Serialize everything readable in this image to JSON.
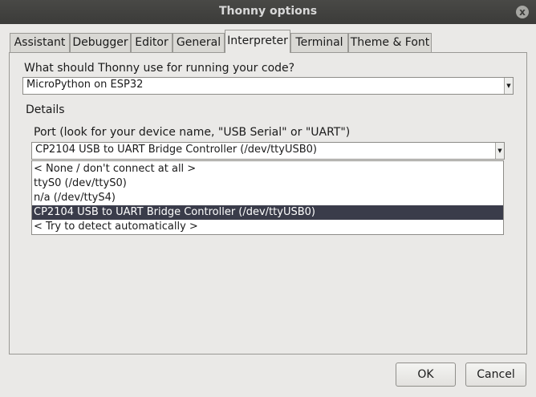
{
  "window": {
    "title": "Thonny options",
    "close_label": "x"
  },
  "tabs": [
    {
      "label": "Assistant",
      "active": false
    },
    {
      "label": "Debugger",
      "active": false
    },
    {
      "label": "Editor",
      "active": false
    },
    {
      "label": "General",
      "active": false
    },
    {
      "label": "Interpreter",
      "active": true
    },
    {
      "label": "Terminal",
      "active": false
    },
    {
      "label": "Theme & Font",
      "active": false
    }
  ],
  "interpreter": {
    "question": "What should Thonny use for running your code?",
    "selected_interpreter": "MicroPython on ESP32",
    "details_heading": "Details",
    "port_label": "Port (look for your device name, \"USB Serial\" or \"UART\")",
    "selected_port": "CP2104 USB to UART Bridge Controller (/dev/ttyUSB0)",
    "port_options": [
      "< None / don't connect at all >",
      "ttyS0 (/dev/ttyS0)",
      "n/a (/dev/ttyS4)",
      "CP2104 USB to UART Bridge Controller (/dev/ttyUSB0)",
      "< Try to detect automatically >"
    ],
    "highlighted_option_index": 3
  },
  "buttons": {
    "ok_label": "OK",
    "cancel_label": "Cancel"
  },
  "colors": {
    "titlebar": "#3b3b39",
    "dialog_bg": "#eae9e7",
    "selection_bg": "#3a3c4a",
    "selection_fg": "#ffffff"
  }
}
